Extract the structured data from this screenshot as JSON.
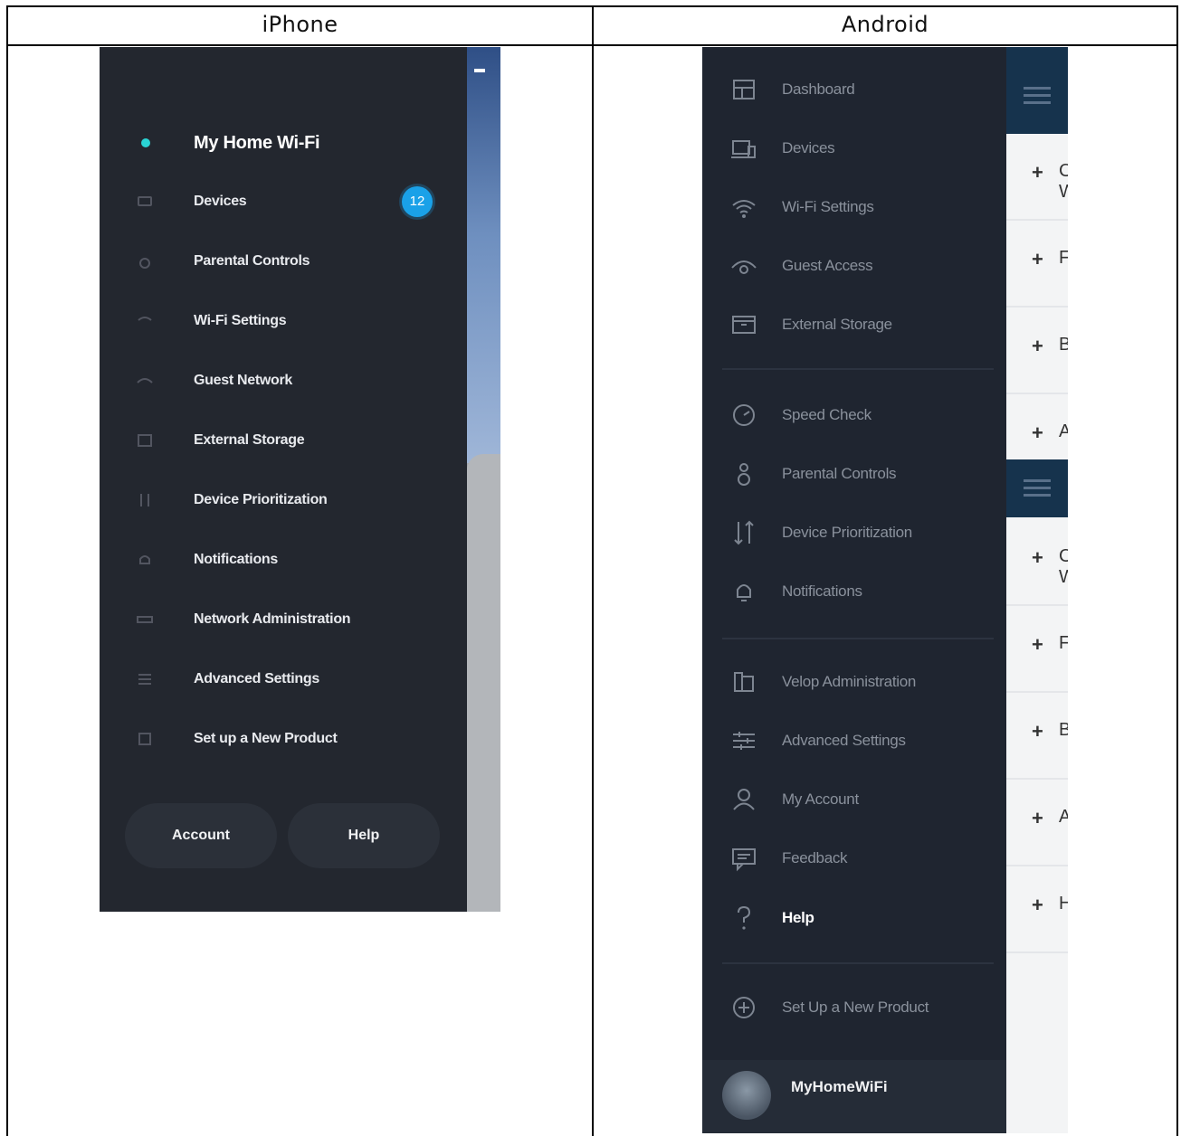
{
  "table": {
    "columns": [
      "iPhone",
      "Android"
    ]
  },
  "iphone": {
    "title": "My Home Wi-Fi",
    "accent_color": "#2ad3d4",
    "badge_color": "#1aa1e8",
    "menu": [
      {
        "label": "Devices",
        "icon": "devices-icon",
        "badge": "12"
      },
      {
        "label": "Parental Controls",
        "icon": "parental-controls-icon"
      },
      {
        "label": "Wi-Fi Settings",
        "icon": "wifi-icon"
      },
      {
        "label": "Guest Network",
        "icon": "guest-network-icon"
      },
      {
        "label": "External Storage",
        "icon": "storage-icon"
      },
      {
        "label": "Device Prioritization",
        "icon": "prioritization-icon"
      },
      {
        "label": "Notifications",
        "icon": "bell-icon"
      },
      {
        "label": "Network Administration",
        "icon": "network-admin-icon"
      },
      {
        "label": "Advanced Settings",
        "icon": "sliders-icon"
      },
      {
        "label": "Set up a New Product",
        "icon": "new-product-icon"
      }
    ],
    "buttons": {
      "account": "Account",
      "help": "Help"
    }
  },
  "android": {
    "menu": [
      {
        "label": "Dashboard",
        "icon": "dashboard-icon"
      },
      {
        "label": "Devices",
        "icon": "devices-icon"
      },
      {
        "label": "Wi-Fi Settings",
        "icon": "wifi-icon"
      },
      {
        "label": "Guest Access",
        "icon": "guest-access-icon"
      },
      {
        "label": "External Storage",
        "icon": "storage-icon"
      },
      {
        "label": "Speed Check",
        "icon": "speed-check-icon"
      },
      {
        "label": "Parental Controls",
        "icon": "parental-controls-icon"
      },
      {
        "label": "Device Prioritization",
        "icon": "prioritization-icon"
      },
      {
        "label": "Notifications",
        "icon": "bell-icon"
      },
      {
        "label": "Velop Administration",
        "icon": "velop-admin-icon"
      },
      {
        "label": "Advanced Settings",
        "icon": "sliders-icon"
      },
      {
        "label": "My Account",
        "icon": "account-icon"
      },
      {
        "label": "Feedback",
        "icon": "feedback-icon"
      },
      {
        "label": "Help",
        "icon": "help-icon",
        "active": true
      },
      {
        "label": "Set Up a New Product",
        "icon": "add-circle-icon"
      }
    ],
    "footer_name": "MyHomeWiFi",
    "side_panel": {
      "group1": [
        "C W",
        "F",
        "B",
        "A"
      ],
      "group2": [
        "C W",
        "F",
        "B",
        "A",
        "H"
      ]
    }
  }
}
